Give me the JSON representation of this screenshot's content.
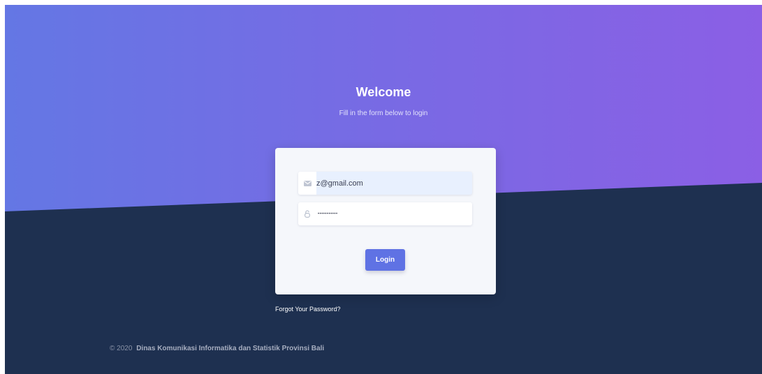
{
  "hero": {
    "title": "Welcome",
    "subtitle": "Fill in the form below to login"
  },
  "form": {
    "email_value": "z@gmail.com",
    "email_icon": "envelope-icon",
    "password_value": "zzzzzzzzzzz",
    "password_icon": "lock-icon",
    "login_label": "Login"
  },
  "links": {
    "forgot_password": "Forgot Your Password?"
  },
  "footer": {
    "copyright": "© 2020",
    "organization": "Dinas Komunikasi Informatika dan Statistik Provinsi Bali"
  },
  "colors": {
    "gradient_start": "#6477e4",
    "gradient_end": "#8b5fe5",
    "background_dark": "#1e3050",
    "button": "#5f72e4",
    "card": "#f5f7fb"
  }
}
